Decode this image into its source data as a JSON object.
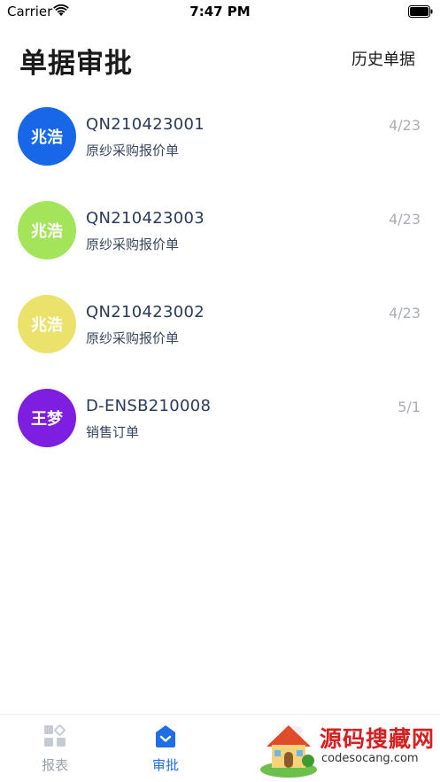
{
  "status_bar": {
    "carrier": "Carrier",
    "time": "7:47 PM"
  },
  "header": {
    "title": "单据审批",
    "history_label": "历史单据"
  },
  "approvals": [
    {
      "avatar_text": "兆浩",
      "avatar_color": "#1767e8",
      "number": "QN210423001",
      "type": "原纱采购报价单",
      "date": "4/23"
    },
    {
      "avatar_text": "兆浩",
      "avatar_color": "#a3e45a",
      "number": "QN210423003",
      "type": "原纱采购报价单",
      "date": "4/23"
    },
    {
      "avatar_text": "兆浩",
      "avatar_color": "#ebe26c",
      "number": "QN210423002",
      "type": "原纱采购报价单",
      "date": "4/23"
    },
    {
      "avatar_text": "王梦",
      "avatar_color": "#7e1ee0",
      "number": "D-ENSB210008",
      "type": "销售订单",
      "date": "5/1"
    }
  ],
  "tab_bar": {
    "tabs": [
      {
        "label": "报表",
        "icon": "grid-icon",
        "active": false
      },
      {
        "label": "审批",
        "icon": "approval-inbox-icon",
        "active": true
      }
    ]
  },
  "watermark": {
    "text": "源码搜藏网",
    "url": "codesocang.com"
  },
  "colors": {
    "accent": "#1f6ee8",
    "inactive": "#9aa0aa"
  }
}
